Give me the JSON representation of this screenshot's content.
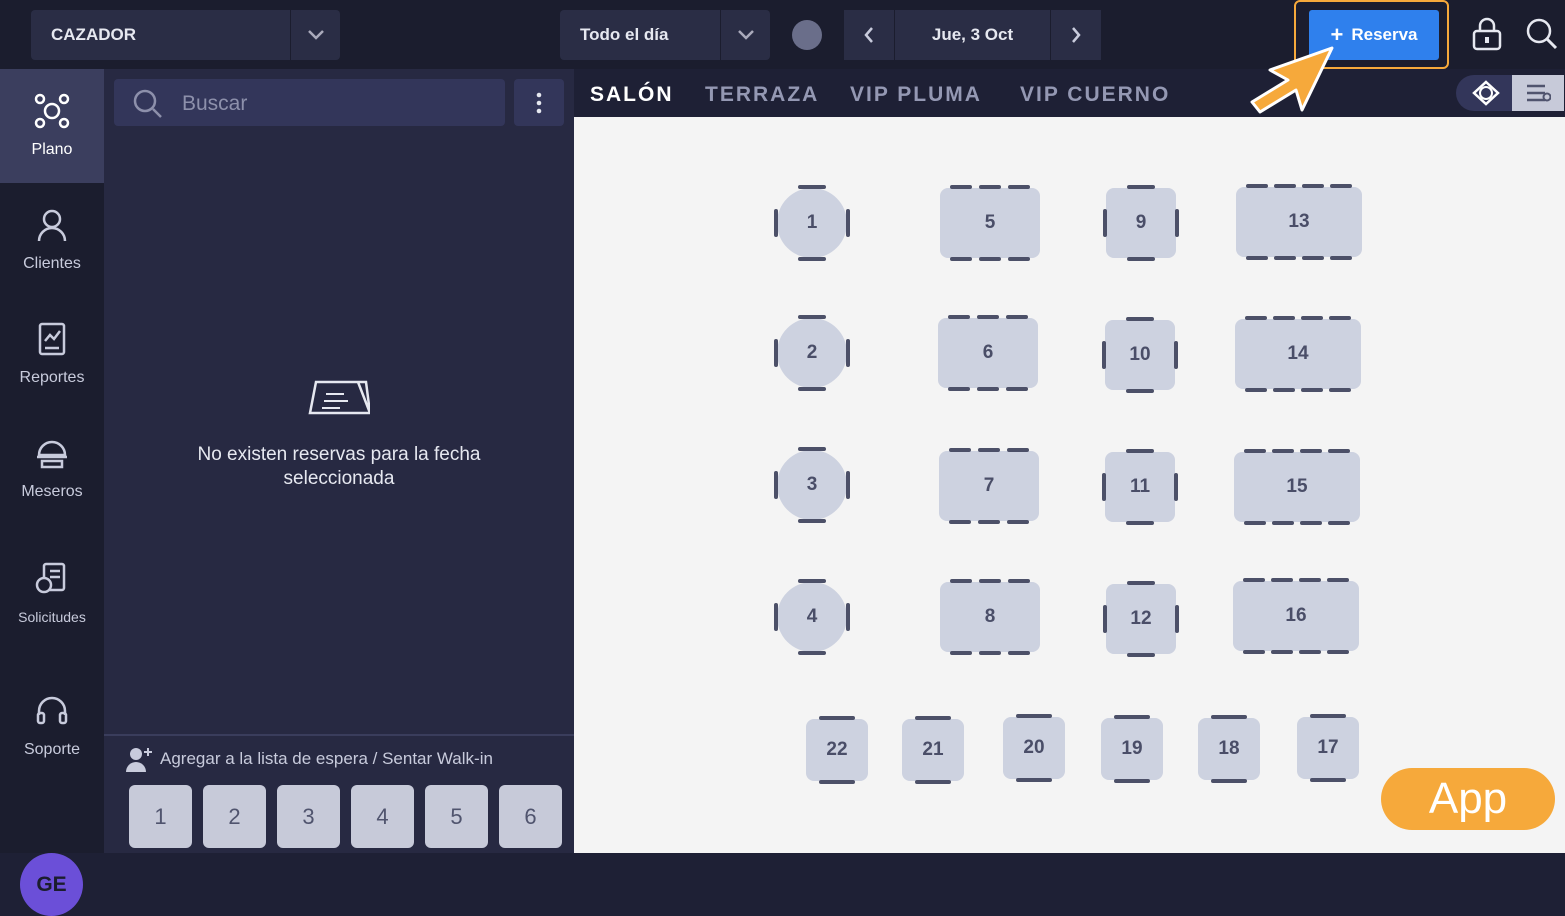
{
  "header": {
    "venue": "CAZADOR",
    "shift": "Todo el día",
    "date": "Jue, 3 Oct",
    "new_reservation": "Reserva"
  },
  "nav": [
    {
      "label": "Plano",
      "icon": "floor-plan-icon",
      "active": true
    },
    {
      "label": "Clientes",
      "icon": "user-icon"
    },
    {
      "label": "Reportes",
      "icon": "reports-icon"
    },
    {
      "label": "Meseros",
      "icon": "waiter-icon"
    },
    {
      "label": "Solicitudes",
      "icon": "requests-icon"
    },
    {
      "label": "Soporte",
      "icon": "headset-icon"
    }
  ],
  "avatar": "GE",
  "panel": {
    "search_placeholder": "Buscar",
    "empty_message": "No existen reservas para la fecha seleccionada",
    "waitlist_label": "Agregar a la lista de espera / Sentar Walk-in",
    "party_sizes": [
      "1",
      "2",
      "3",
      "4",
      "5",
      "6"
    ]
  },
  "tabs": [
    "SALÓN",
    "TERRAZA",
    "VIP PLUMA",
    "VIP CUERNO"
  ],
  "active_tab": "SALÓN",
  "tables": [
    "1",
    "2",
    "3",
    "4",
    "5",
    "6",
    "7",
    "8",
    "9",
    "10",
    "11",
    "12",
    "13",
    "14",
    "15",
    "16",
    "17",
    "18",
    "19",
    "20",
    "21",
    "22"
  ],
  "badge": "App",
  "colors": {
    "accent": "#2f80ed",
    "highlight": "#f6a93b",
    "table": "#cdd2e0"
  }
}
